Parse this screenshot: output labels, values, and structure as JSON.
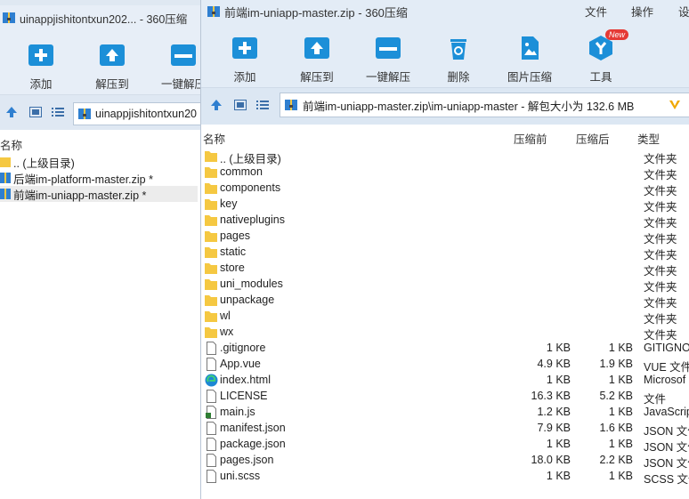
{
  "back_window": {
    "title": "uinappjishitontxun202... - 360压缩",
    "toolbar": [
      {
        "label": "添加",
        "icon": "add-icon"
      },
      {
        "label": "解压到",
        "icon": "extract-to-icon"
      },
      {
        "label": "一键解压",
        "icon": "one-click-extract-icon"
      }
    ],
    "address": "uinappjishitontxun20",
    "column_name": "名称",
    "items": [
      {
        "name": ".. (上级目录)",
        "type": "folder"
      },
      {
        "name": "后端im-platform-master.zip *",
        "type": "zip"
      },
      {
        "name": "前端im-uniapp-master.zip *",
        "type": "zip"
      }
    ]
  },
  "front_window": {
    "title": "前端im-uniapp-master.zip - 360压缩",
    "menu": [
      "文件",
      "操作",
      "设"
    ],
    "toolbar": [
      {
        "label": "添加",
        "icon": "add-icon"
      },
      {
        "label": "解压到",
        "icon": "extract-to-icon"
      },
      {
        "label": "一键解压",
        "icon": "one-click-extract-icon"
      },
      {
        "label": "删除",
        "icon": "delete-icon"
      },
      {
        "label": "图片压缩",
        "icon": "image-compress-icon"
      },
      {
        "label": "工具",
        "icon": "tools-icon",
        "badge": "New"
      }
    ],
    "address": "前端im-uniapp-master.zip\\im-uniapp-master - 解包大小为 132.6 MB",
    "columns": [
      "名称",
      "压缩前",
      "压缩后",
      "类型"
    ],
    "rows": [
      {
        "name": ".. (上级目录)",
        "before": "",
        "after": "",
        "type": "文件夹",
        "icon": "folder"
      },
      {
        "name": "common",
        "before": "",
        "after": "",
        "type": "文件夹",
        "icon": "folder"
      },
      {
        "name": "components",
        "before": "",
        "after": "",
        "type": "文件夹",
        "icon": "folder"
      },
      {
        "name": "key",
        "before": "",
        "after": "",
        "type": "文件夹",
        "icon": "folder"
      },
      {
        "name": "nativeplugins",
        "before": "",
        "after": "",
        "type": "文件夹",
        "icon": "folder"
      },
      {
        "name": "pages",
        "before": "",
        "after": "",
        "type": "文件夹",
        "icon": "folder"
      },
      {
        "name": "static",
        "before": "",
        "after": "",
        "type": "文件夹",
        "icon": "folder"
      },
      {
        "name": "store",
        "before": "",
        "after": "",
        "type": "文件夹",
        "icon": "folder"
      },
      {
        "name": "uni_modules",
        "before": "",
        "after": "",
        "type": "文件夹",
        "icon": "folder"
      },
      {
        "name": "unpackage",
        "before": "",
        "after": "",
        "type": "文件夹",
        "icon": "folder"
      },
      {
        "name": "wl",
        "before": "",
        "after": "",
        "type": "文件夹",
        "icon": "folder"
      },
      {
        "name": "wx",
        "before": "",
        "after": "",
        "type": "文件夹",
        "icon": "folder"
      },
      {
        "name": ".gitignore",
        "before": "1 KB",
        "after": "1 KB",
        "type": "GITIGNO",
        "icon": "file"
      },
      {
        "name": "App.vue",
        "before": "4.9 KB",
        "after": "1.9 KB",
        "type": "VUE 文件",
        "icon": "file"
      },
      {
        "name": "index.html",
        "before": "1 KB",
        "after": "1 KB",
        "type": "Microsof",
        "icon": "edge"
      },
      {
        "name": "LICENSE",
        "before": "16.3 KB",
        "after": "5.2 KB",
        "type": "文件",
        "icon": "file"
      },
      {
        "name": "main.js",
        "before": "1.2 KB",
        "after": "1 KB",
        "type": "JavaScrip",
        "icon": "js"
      },
      {
        "name": "manifest.json",
        "before": "7.9 KB",
        "after": "1.6 KB",
        "type": "JSON 文件",
        "icon": "file"
      },
      {
        "name": "package.json",
        "before": "1 KB",
        "after": "1 KB",
        "type": "JSON 文件",
        "icon": "file"
      },
      {
        "name": "pages.json",
        "before": "18.0 KB",
        "after": "2.2 KB",
        "type": "JSON 文件",
        "icon": "file"
      },
      {
        "name": "uni.scss",
        "before": "1 KB",
        "after": "1 KB",
        "type": "SCSS 文件",
        "icon": "file"
      }
    ]
  },
  "colors": {
    "accent_blue": "#1c8fd8",
    "folder_yellow": "#f5c842",
    "toolbar_bg": "#e3ecf6"
  }
}
